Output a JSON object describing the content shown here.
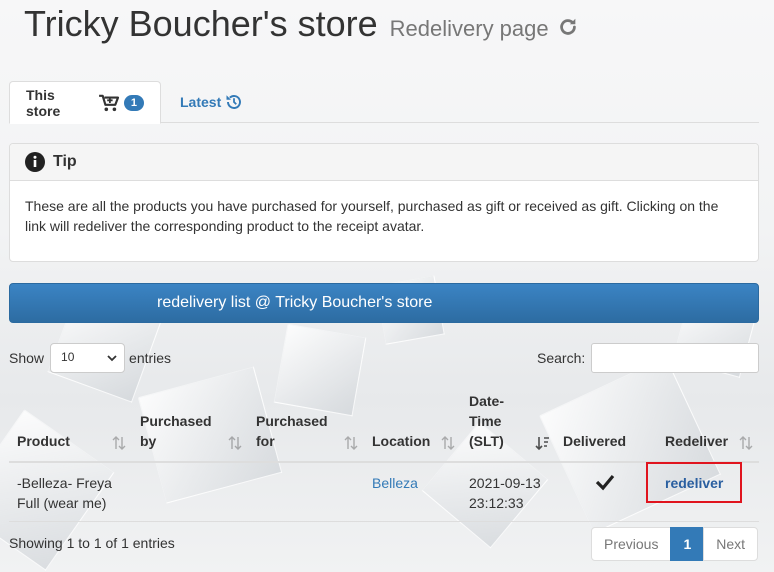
{
  "header": {
    "title": "Tricky Boucher's store",
    "subtitle": "Redelivery page"
  },
  "tabs": [
    {
      "label": "This store",
      "badge": "1",
      "active": true
    },
    {
      "label": "Latest",
      "active": false
    }
  ],
  "tip": {
    "heading": "Tip",
    "body": "These are all the products you have purchased for yourself, purchased as gift or received as gift. Clicking on the link will redeliver the corresponding product to the receipt avatar."
  },
  "list_title": "redelivery list @ Tricky Boucher's store",
  "controls": {
    "show_label": "Show",
    "entries_value": "10",
    "entries_label": "entries",
    "search_label": "Search:",
    "search_value": ""
  },
  "table": {
    "columns": [
      "Product",
      "Purchased by",
      "Purchased for",
      "Location",
      "Date-Time (SLT)",
      "Delivered",
      "Redeliver"
    ],
    "rows": [
      {
        "product": "-Belleza- Freya Full (wear me)",
        "purchased_by": "",
        "purchased_for": "",
        "location": "Belleza",
        "datetime": "2021-09-13 23:12:33",
        "delivered": "check-icon",
        "redeliver": "redeliver"
      }
    ]
  },
  "footer": {
    "info": "Showing 1 to 1 of 1 entries",
    "pager": {
      "previous": "Previous",
      "page": "1",
      "next": "Next"
    }
  },
  "colors": {
    "primary": "#337ab7",
    "highlight_box": "#e0141e"
  }
}
